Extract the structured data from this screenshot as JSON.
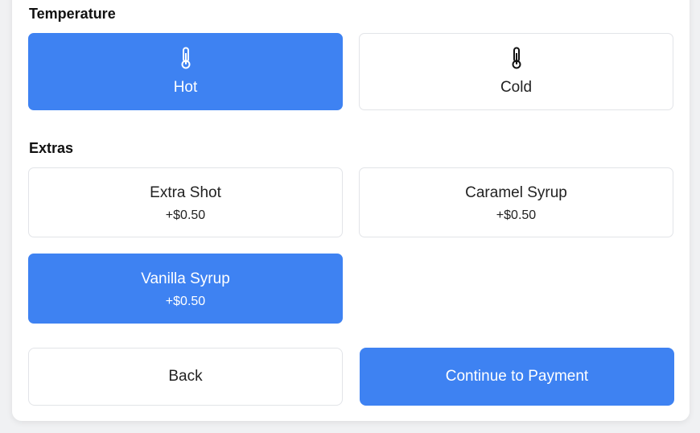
{
  "temperature": {
    "title": "Temperature",
    "options": [
      {
        "label": "Hot",
        "icon": "thermometer-icon",
        "selected": true
      },
      {
        "label": "Cold",
        "icon": "thermometer-icon",
        "selected": false
      }
    ]
  },
  "extras": {
    "title": "Extras",
    "options": [
      {
        "name": "Extra Shot",
        "price": "+$0.50",
        "selected": false
      },
      {
        "name": "Caramel Syrup",
        "price": "+$0.50",
        "selected": false
      },
      {
        "name": "Vanilla Syrup",
        "price": "+$0.50",
        "selected": true
      }
    ]
  },
  "actions": {
    "back_label": "Back",
    "continue_label": "Continue to Payment"
  },
  "colors": {
    "accent": "#3e82f2",
    "border": "#e2e4e8",
    "background": "#f0f1f3"
  }
}
